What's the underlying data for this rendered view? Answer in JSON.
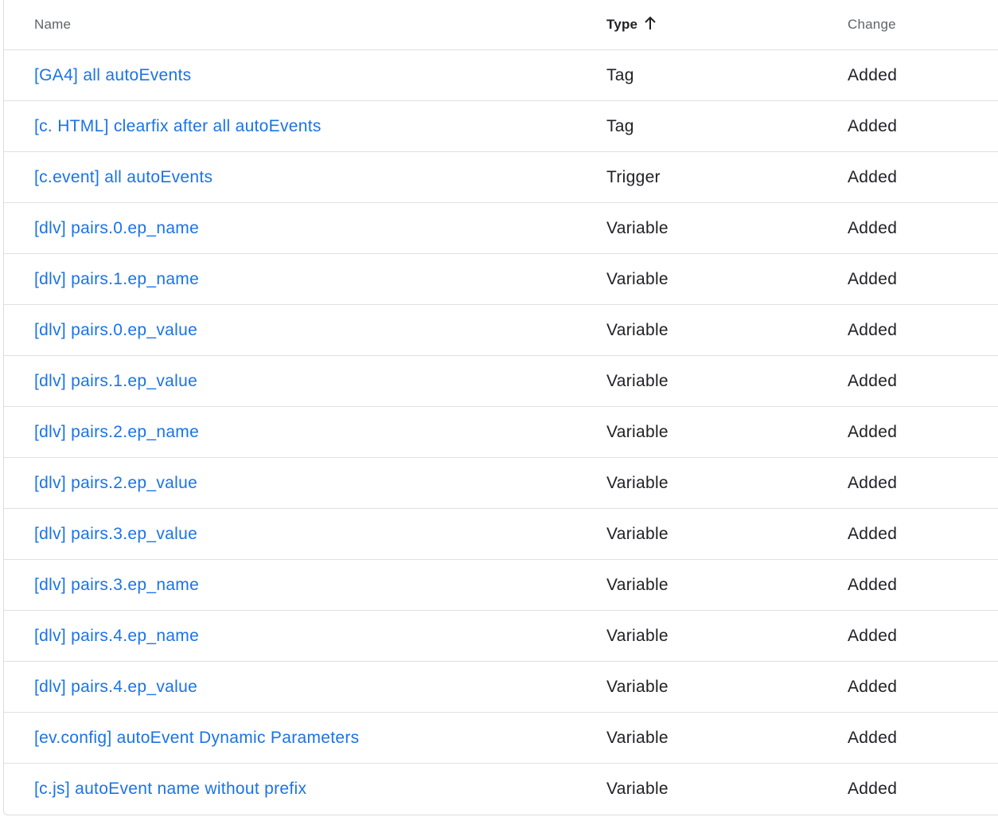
{
  "header": {
    "name": "Name",
    "type": "Type",
    "change": "Change",
    "sort_icon": "arrow-upward-icon"
  },
  "rows": [
    {
      "name": "[GA4] all autoEvents",
      "type": "Tag",
      "change": "Added"
    },
    {
      "name": "[c. HTML] clearfix after all autoEvents",
      "type": "Tag",
      "change": "Added"
    },
    {
      "name": "[c.event] all autoEvents",
      "type": "Trigger",
      "change": "Added"
    },
    {
      "name": "[dlv] pairs.0.ep_name",
      "type": "Variable",
      "change": "Added"
    },
    {
      "name": "[dlv] pairs.1.ep_name",
      "type": "Variable",
      "change": "Added"
    },
    {
      "name": "[dlv] pairs.0.ep_value",
      "type": "Variable",
      "change": "Added"
    },
    {
      "name": "[dlv] pairs.1.ep_value",
      "type": "Variable",
      "change": "Added"
    },
    {
      "name": "[dlv] pairs.2.ep_name",
      "type": "Variable",
      "change": "Added"
    },
    {
      "name": "[dlv] pairs.2.ep_value",
      "type": "Variable",
      "change": "Added"
    },
    {
      "name": "[dlv] pairs.3.ep_value",
      "type": "Variable",
      "change": "Added"
    },
    {
      "name": "[dlv] pairs.3.ep_name",
      "type": "Variable",
      "change": "Added"
    },
    {
      "name": "[dlv] pairs.4.ep_name",
      "type": "Variable",
      "change": "Added"
    },
    {
      "name": "[dlv] pairs.4.ep_value",
      "type": "Variable",
      "change": "Added"
    },
    {
      "name": "[ev.config] autoEvent Dynamic Parameters",
      "type": "Variable",
      "change": "Added"
    },
    {
      "name": "[c.js] autoEvent name without prefix",
      "type": "Variable",
      "change": "Added"
    }
  ],
  "colors": {
    "link": "#1a73e8",
    "text": "#202124",
    "header_text": "#5f6368",
    "divider": "#e0e0e0"
  }
}
